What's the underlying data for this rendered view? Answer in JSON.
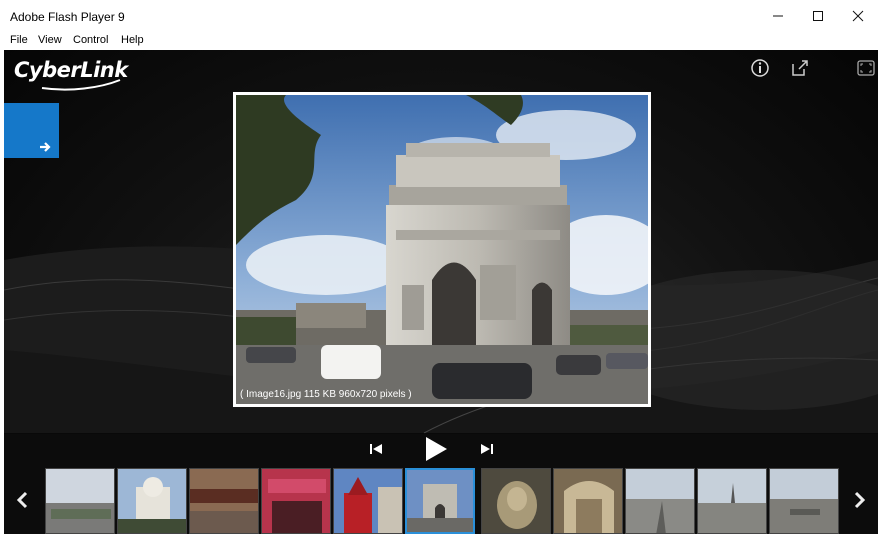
{
  "window": {
    "title": "Adobe Flash Player 9"
  },
  "menu": [
    "File",
    "View",
    "Control",
    "Help"
  ],
  "brand": {
    "name": "CyberLink",
    "accent": "#1578c9"
  },
  "icons": {
    "info": "info-icon",
    "popout": "popout-icon",
    "fullscreen": "fullscreen-icon",
    "next": "arrow-right-icon"
  },
  "photo": {
    "caption": "( Image16.jpg 115 KB  960x720 pixels )"
  },
  "player": {
    "buttons": [
      "previous-icon",
      "play-icon",
      "next-icon"
    ]
  },
  "thumbnails": {
    "selected_index": 5,
    "items": [
      {
        "subject": "city-overview"
      },
      {
        "subject": "sacre-coeur"
      },
      {
        "subject": "cafe-street"
      },
      {
        "subject": "shop-front"
      },
      {
        "subject": "moulin-rouge"
      },
      {
        "subject": "arc-de-triomphe"
      },
      {
        "subject": "statue-relief"
      },
      {
        "subject": "arch-interior"
      },
      {
        "subject": "avenue-view"
      },
      {
        "subject": "eiffel-distance"
      },
      {
        "subject": "rooftops"
      }
    ]
  }
}
